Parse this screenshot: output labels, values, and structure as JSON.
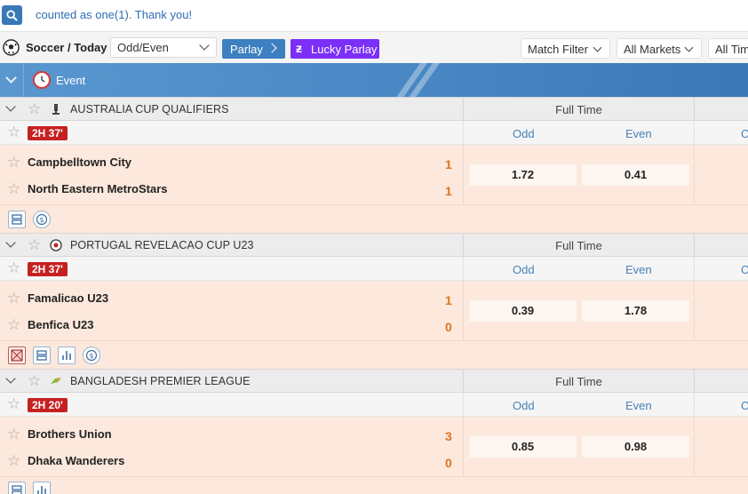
{
  "topbar": {
    "ticker": "counted as one(1). Thank you!"
  },
  "filterbar": {
    "sport_title": "Soccer / Today",
    "bet_type": "Odd/Even",
    "parlay": "Parlay",
    "lucky_parlay": "Lucky Parlay",
    "match_filter": "Match Filter",
    "all_markets": "All Markets",
    "all_time": "All Tim"
  },
  "header": {
    "event_label": "Event"
  },
  "colors": {
    "accent": "#3d7fc0",
    "lucky": "#7b2ff7",
    "live": "#c62121",
    "score": "#e0731a"
  },
  "leagues": [
    {
      "name": "AUSTRALIA CUP QUALIFIERS",
      "full_time": "Full Time",
      "odd_label": "Odd",
      "even_label": "Even",
      "c_label": "C",
      "time": "2H 37'",
      "home": "Campbelltown City",
      "away": "North Eastern MetroStars",
      "home_score": "1",
      "away_score": "1",
      "odd": "1.72",
      "even": "0.41"
    },
    {
      "name": "PORTUGAL REVELACAO CUP U23",
      "full_time": "Full Time",
      "odd_label": "Odd",
      "even_label": "Even",
      "c_label": "C",
      "time": "2H 37'",
      "home": "Famalicao U23",
      "away": "Benfica U23",
      "home_score": "1",
      "away_score": "0",
      "odd": "0.39",
      "even": "1.78"
    },
    {
      "name": "BANGLADESH PREMIER LEAGUE",
      "full_time": "Full Time",
      "odd_label": "Odd",
      "even_label": "Even",
      "c_label": "C",
      "time": "2H 20'",
      "home": "Brothers Union",
      "away": "Dhaka Wanderers",
      "home_score": "3",
      "away_score": "0",
      "odd": "0.85",
      "even": "0.98"
    }
  ]
}
